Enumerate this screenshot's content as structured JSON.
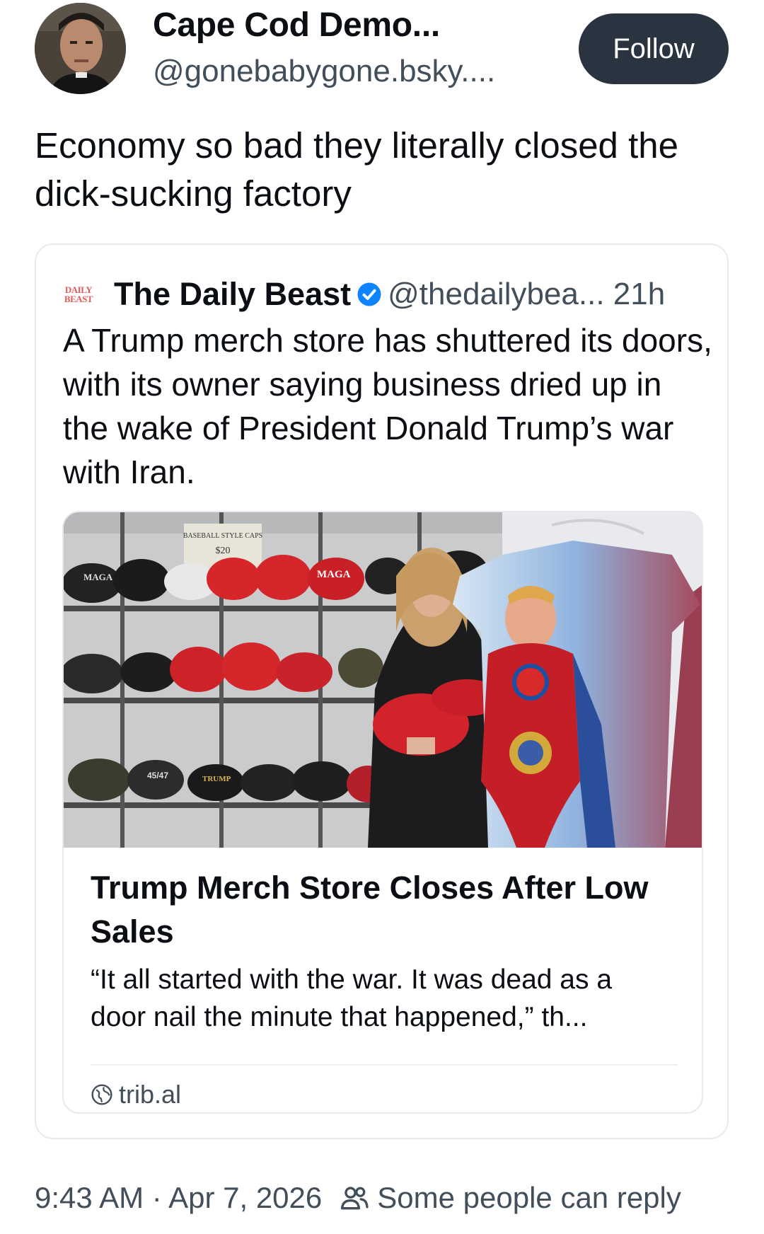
{
  "post": {
    "author_name": "Cape Cod Demo...",
    "author_handle": "@gonebabygone.bsky....",
    "follow_label": "Follow",
    "text": "Economy so bad they literally closed the dick-sucking factory"
  },
  "quote": {
    "logo_text_top": "DAILY",
    "logo_text_bottom": "BEAST",
    "name": "The Daily Beast",
    "handle_time": "@thedailybea... 21h",
    "text": "A Trump merch store has shuttered its doors, with its owner saying business dried up in the wake of President Donald Trump’s war with Iran.",
    "link": {
      "title": "Trump Merch Store Closes After Low Sales",
      "description": "“It all started with the war. It was dead as a door nail the minute that happened,” th...",
      "domain": "trib.al"
    },
    "thumbnail_labels": {
      "sign_line1": "BASEBALL STYLE CAPS",
      "sign_line2": "$20",
      "cap1": "MAGA",
      "cap2": "MAGA",
      "cap3": "45/47",
      "cap4": "TRUMP"
    }
  },
  "footer": {
    "timestamp": "9:43 AM · Apr 7, 2026",
    "reply_setting": "Some people can reply"
  },
  "colors": {
    "follow_bg": "#2a3440",
    "verified_blue": "#1083fe",
    "muted_text": "#434e5b",
    "daily_beast_red": "#e25b5b"
  },
  "icons": [
    "verified-badge-icon",
    "globe-icon",
    "people-icon"
  ]
}
